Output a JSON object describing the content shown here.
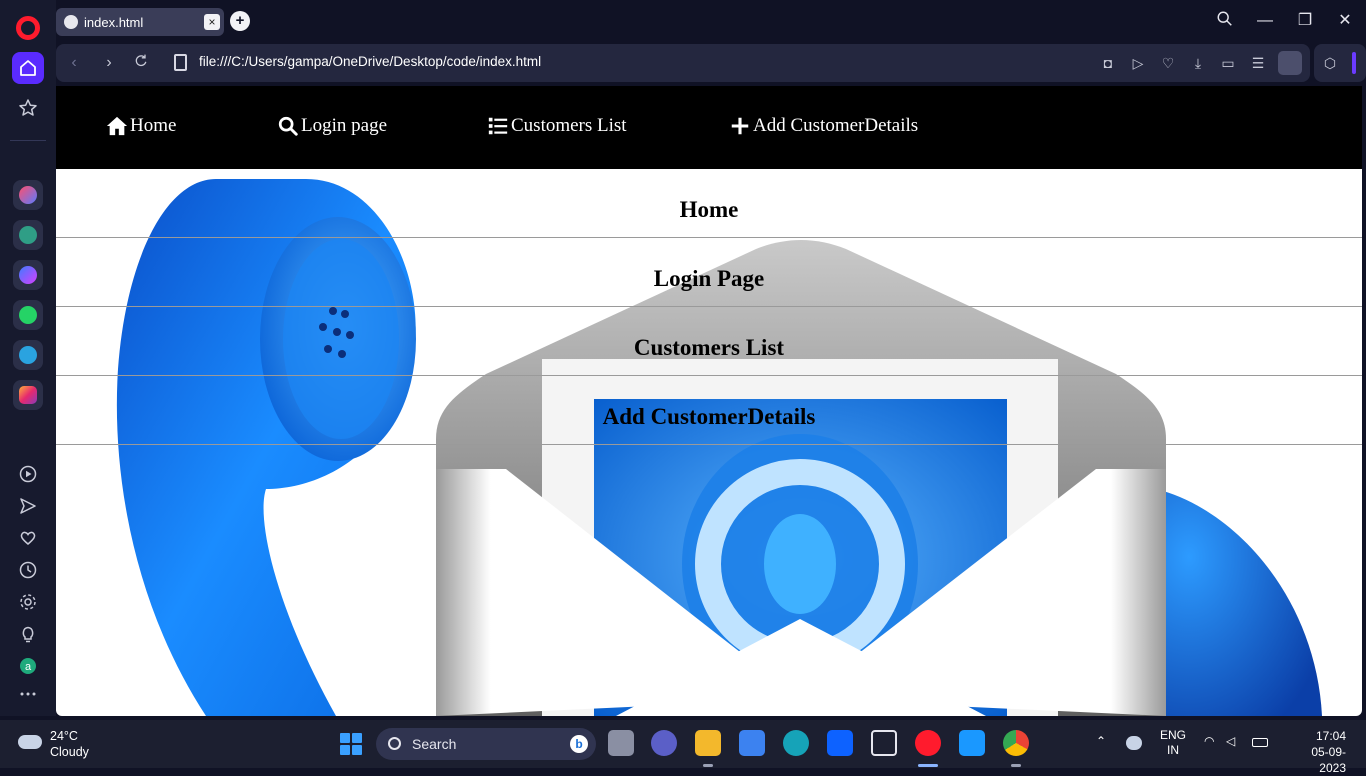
{
  "browser": {
    "tab_title": "index.html",
    "tab_close": "×",
    "new_tab": "+",
    "url": "file:///C:/Users/gampa/OneDrive/Desktop/code/index.html",
    "win_minimize": "—",
    "win_restore": "❐",
    "win_close": "✕",
    "accent_color": "#5a2bff"
  },
  "site_nav": {
    "items": [
      {
        "label": "Home",
        "icon": "home-icon"
      },
      {
        "label": "Login page",
        "icon": "search-icon"
      },
      {
        "label": "Customers List",
        "icon": "list-icon"
      },
      {
        "label": "Add CustomerDetails",
        "icon": "plus-icon"
      }
    ]
  },
  "links": [
    {
      "label": "Home"
    },
    {
      "label": "Login Page"
    },
    {
      "label": "Customers List"
    },
    {
      "label": "Add CustomerDetails"
    }
  ],
  "taskbar": {
    "temperature": "24°C",
    "condition": "Cloudy",
    "search_label": "Search",
    "language_top": "ENG",
    "language_bottom": "IN",
    "time": "17:04",
    "date": "05-09-2023"
  }
}
